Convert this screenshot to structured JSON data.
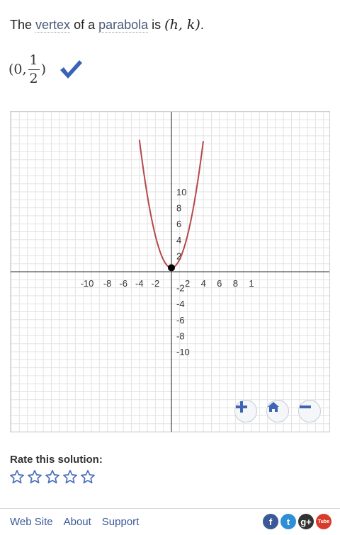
{
  "statement": {
    "text_1": "The ",
    "term_1": "vertex",
    "text_2": " of a ",
    "term_2": "parabola",
    "text_3": " is ",
    "math": "(h, k)",
    "period": "."
  },
  "answer": {
    "open": "(0,",
    "numerator": "1",
    "denominator": "2",
    "close": ")",
    "check_color": "#3a63b8"
  },
  "graph": {
    "x_ticks": [
      "-10",
      "-8",
      "-6",
      "-4",
      "-2",
      "2",
      "4",
      "6",
      "8",
      "1"
    ],
    "y_ticks": [
      "10",
      "8",
      "6",
      "4",
      "2",
      "-2",
      "-4",
      "-6",
      "-8",
      "-10"
    ],
    "x_range": [
      -10,
      10
    ],
    "y_range": [
      -10,
      10
    ],
    "curve": {
      "a": 1,
      "h": 0,
      "k": 0.5,
      "color": "#b5484a"
    },
    "vertex_point": {
      "x": 0,
      "y": 0.5
    },
    "zoom_in_icon": "plus-icon",
    "home_icon": "home-icon",
    "zoom_out_icon": "minus-icon",
    "accent": "#3f64b4"
  },
  "rating": {
    "title": "Rate this solution:",
    "stars": 5,
    "star_color": "#4a6fb5"
  },
  "footer": {
    "links": [
      "Web Site",
      "About",
      "Support"
    ],
    "social": [
      {
        "icon": "facebook-icon",
        "glyph": "f",
        "color": "#3b5998"
      },
      {
        "icon": "twitter-icon",
        "glyph": "t",
        "color": "#2f8fd6"
      },
      {
        "icon": "google-plus-icon",
        "glyph": "g+",
        "color": "#333333"
      },
      {
        "icon": "youtube-icon",
        "glyph": "Tube",
        "color": "#d93b2b"
      }
    ]
  }
}
